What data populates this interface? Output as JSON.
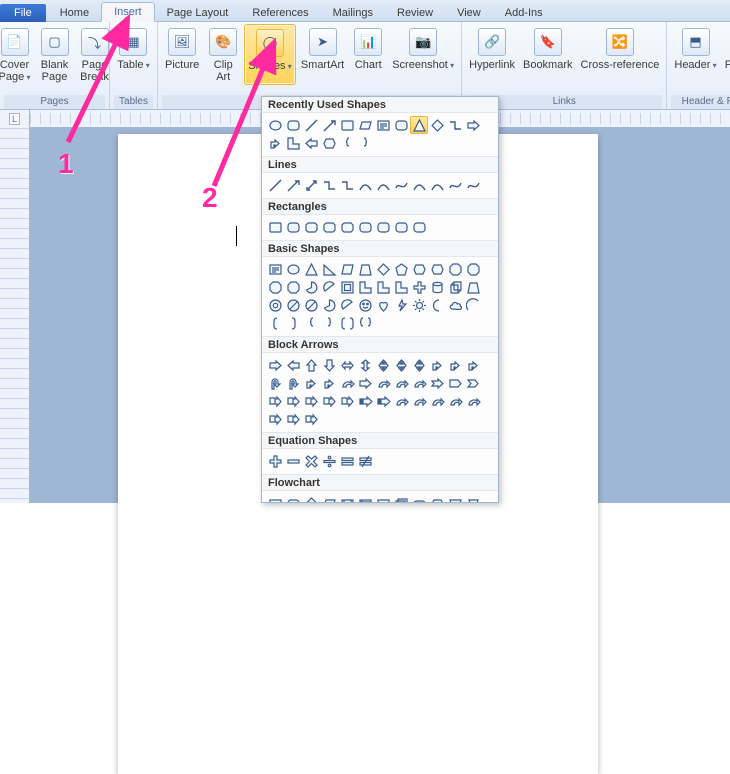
{
  "tabs": {
    "file": "File",
    "items": [
      "Home",
      "Insert",
      "Page Layout",
      "References",
      "Mailings",
      "Review",
      "View",
      "Add-Ins"
    ],
    "active_index": 1
  },
  "ribbon": {
    "pages": {
      "label": "Pages",
      "cover_page": "Cover\nPage",
      "blank_page": "Blank\nPage",
      "page_break": "Page\nBreak"
    },
    "tables": {
      "label": "Tables",
      "table": "Table"
    },
    "illustrations": {
      "picture": "Picture",
      "clip_art": "Clip\nArt",
      "shapes": "Shapes",
      "smartart": "SmartArt",
      "chart": "Chart",
      "screenshot": "Screenshot"
    },
    "links": {
      "label": "Links",
      "hyperlink": "Hyperlink",
      "bookmark": "Bookmark",
      "crossref": "Cross-reference"
    },
    "headerfooter": {
      "label": "Header & Footer",
      "header": "Header",
      "footer": "Footer"
    }
  },
  "shapes_panel": {
    "sections": {
      "recent": "Recently Used Shapes",
      "lines": "Lines",
      "rectangles": "Rectangles",
      "basic": "Basic Shapes",
      "block_arrows": "Block Arrows",
      "equation": "Equation Shapes",
      "flowchart": "Flowchart"
    },
    "recent_selected_index": 8
  },
  "annotations": {
    "one": "1",
    "two": "2"
  },
  "chart_data": null
}
